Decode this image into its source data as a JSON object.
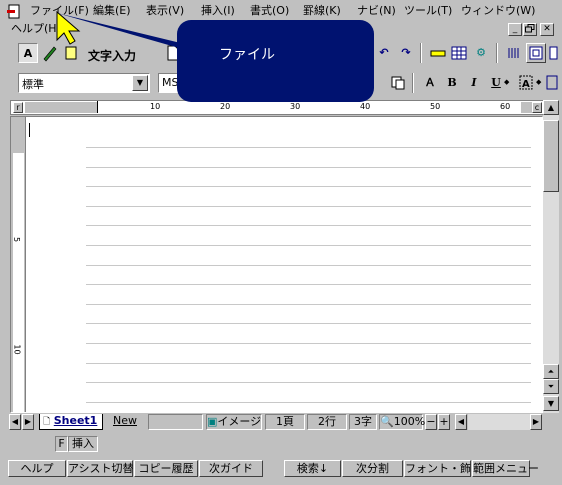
{
  "menubar": {
    "items": [
      "ファイル(F)",
      "編集(E)",
      "表示(V)",
      "挿入(I)",
      "書式(O)",
      "罫線(K)",
      "ナビ(N)",
      "ツール(T)",
      "ウィンドウ(W)"
    ],
    "help": "ヘルプ(H)",
    "window_controls": [
      "_",
      "▫",
      "✕"
    ]
  },
  "toolbar": {
    "text_input_label": "文字入力"
  },
  "format_bar": {
    "style_value": "標準",
    "font_value": "MS"
  },
  "ruler": {
    "marks": [
      "10",
      "20",
      "30",
      "40",
      "50",
      "60"
    ],
    "left_label": "r",
    "right_label": "c"
  },
  "vertical_ruler": {
    "marks": [
      "5",
      "10"
    ]
  },
  "tabs": {
    "sheet1": "Sheet1",
    "new": "New"
  },
  "status": {
    "view_mode": "イメージ",
    "page": "1頁",
    "line": "2行",
    "column": "3字",
    "zoom": "100%",
    "zoom_minus": "−",
    "zoom_plus": "+"
  },
  "modebar": {
    "f": "F",
    "mode": "挿入"
  },
  "fkeys": [
    "ヘルプ",
    "アシスト切替",
    "コピー履歴",
    "次ガイド",
    "検索↓",
    "次分割",
    "フォント・飾り",
    "範囲メニュー"
  ],
  "tooltip": {
    "text": "ファイル"
  },
  "colors": {
    "balloon": "#001270",
    "cursor": "#ffff00",
    "face": "#c0c0c0"
  }
}
